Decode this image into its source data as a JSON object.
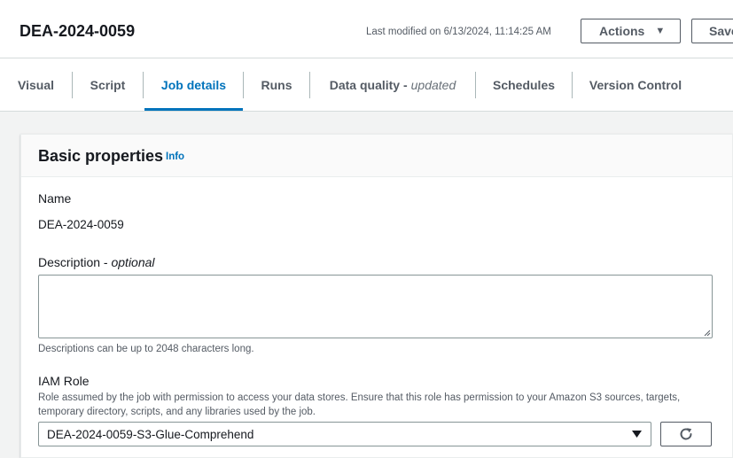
{
  "header": {
    "title": "DEA-2024-0059",
    "last_modified": "Last modified on 6/13/2024, 11:14:25 AM",
    "actions_label": "Actions",
    "save_label": "Save"
  },
  "tabs": [
    {
      "label": "Visual"
    },
    {
      "label": "Script"
    },
    {
      "label": "Job details",
      "active": true
    },
    {
      "label": "Runs"
    },
    {
      "label": "Data quality -",
      "suffix": "updated"
    },
    {
      "label": "Schedules"
    },
    {
      "label": "Version Control"
    }
  ],
  "panel": {
    "title": "Basic properties",
    "info_label": "Info",
    "name_label": "Name",
    "name_value": "DEA-2024-0059",
    "description_label": "Description -",
    "description_optional": "optional",
    "description_value": "",
    "description_hint": "Descriptions can be up to 2048 characters long.",
    "iam_label": "IAM Role",
    "iam_hint": "Role assumed by the job with permission to access your data stores. Ensure that this role has permission to your Amazon S3 sources, targets, temporary directory, scripts, and any libraries used by the job.",
    "iam_value": "DEA-2024-0059-S3-Glue-Comprehend"
  },
  "icons": {
    "actions_caret": "caret-down-icon",
    "select_caret": "caret-down-icon",
    "refresh": "refresh-icon"
  },
  "colors": {
    "accent": "#0073bb",
    "text": "#16191f",
    "muted": "#545b64",
    "background": "#f2f3f3"
  }
}
